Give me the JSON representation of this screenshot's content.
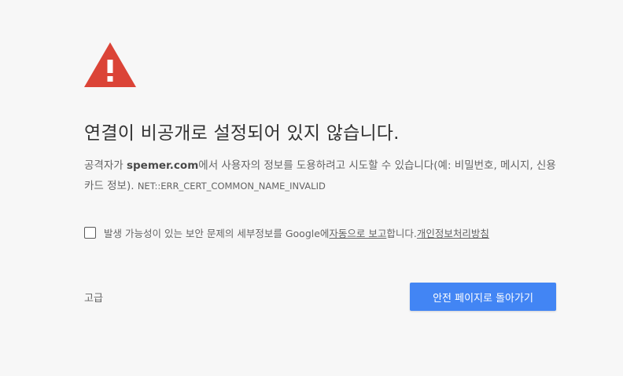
{
  "icon": "warning-triangle-icon",
  "colors": {
    "background": "#f7f7f7",
    "warning_red": "#db4437",
    "button_blue": "#4285f4"
  },
  "heading": "연결이 비공개로 설정되어 있지 않습니다.",
  "explanation": {
    "prefix": "공격자가 ",
    "host": "spemer.com",
    "suffix": "에서 사용자의 정보를 도용하려고 시도할 수 있습니다(예: 비밀번호, 메시지, 신용카드 정보). ",
    "error_code": "NET::ERR_CERT_COMMON_NAME_INVALID"
  },
  "report": {
    "text": "발생 가능성이 있는 보안 문제의 세부정보를 Google에 ",
    "link_auto": "자동으로 보고",
    "middle": "합니다. ",
    "link_privacy": "개인정보처리방침"
  },
  "advanced_label": "고급",
  "back_button_label": "안전 페이지로 돌아가기"
}
